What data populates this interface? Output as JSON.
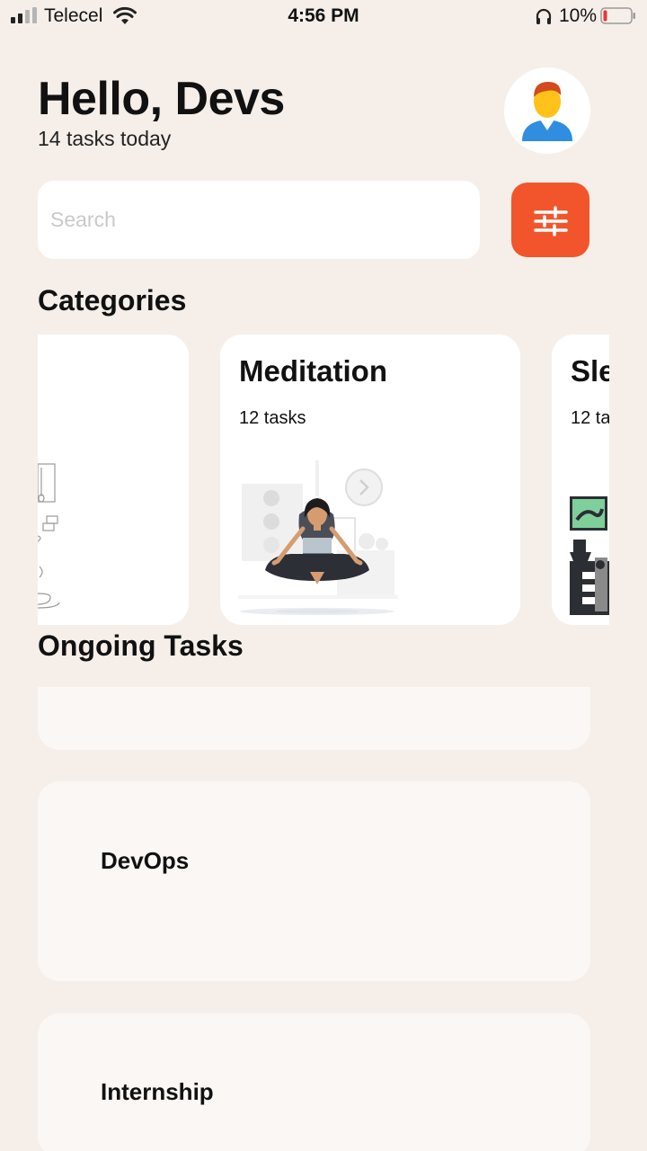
{
  "status_bar": {
    "carrier": "Telecel",
    "time": "4:56 PM",
    "battery": "10%",
    "icons": [
      "signal-icon",
      "wifi-icon",
      "headphones-icon",
      "battery-icon"
    ]
  },
  "header": {
    "title": "Hello, Devs",
    "subtitle": "14 tasks today",
    "avatar": "user-avatar-icon"
  },
  "search": {
    "placeholder": "Search",
    "value": "",
    "filter_icon": "sliders-icon"
  },
  "categories": {
    "title": "Categories",
    "items": [
      {
        "title": "",
        "count": ""
      },
      {
        "title": "Meditation",
        "count": "12 tasks"
      },
      {
        "title": "Sle",
        "count": "12 ta"
      }
    ]
  },
  "ongoing": {
    "title": "Ongoing Tasks",
    "items": [
      {
        "title": ""
      },
      {
        "title": "DevOps"
      },
      {
        "title": "Internship"
      }
    ]
  },
  "colors": {
    "background": "#f6efe9",
    "accent": "#f2552c",
    "card": "#ffffff",
    "task_card": "#faf7f4"
  }
}
